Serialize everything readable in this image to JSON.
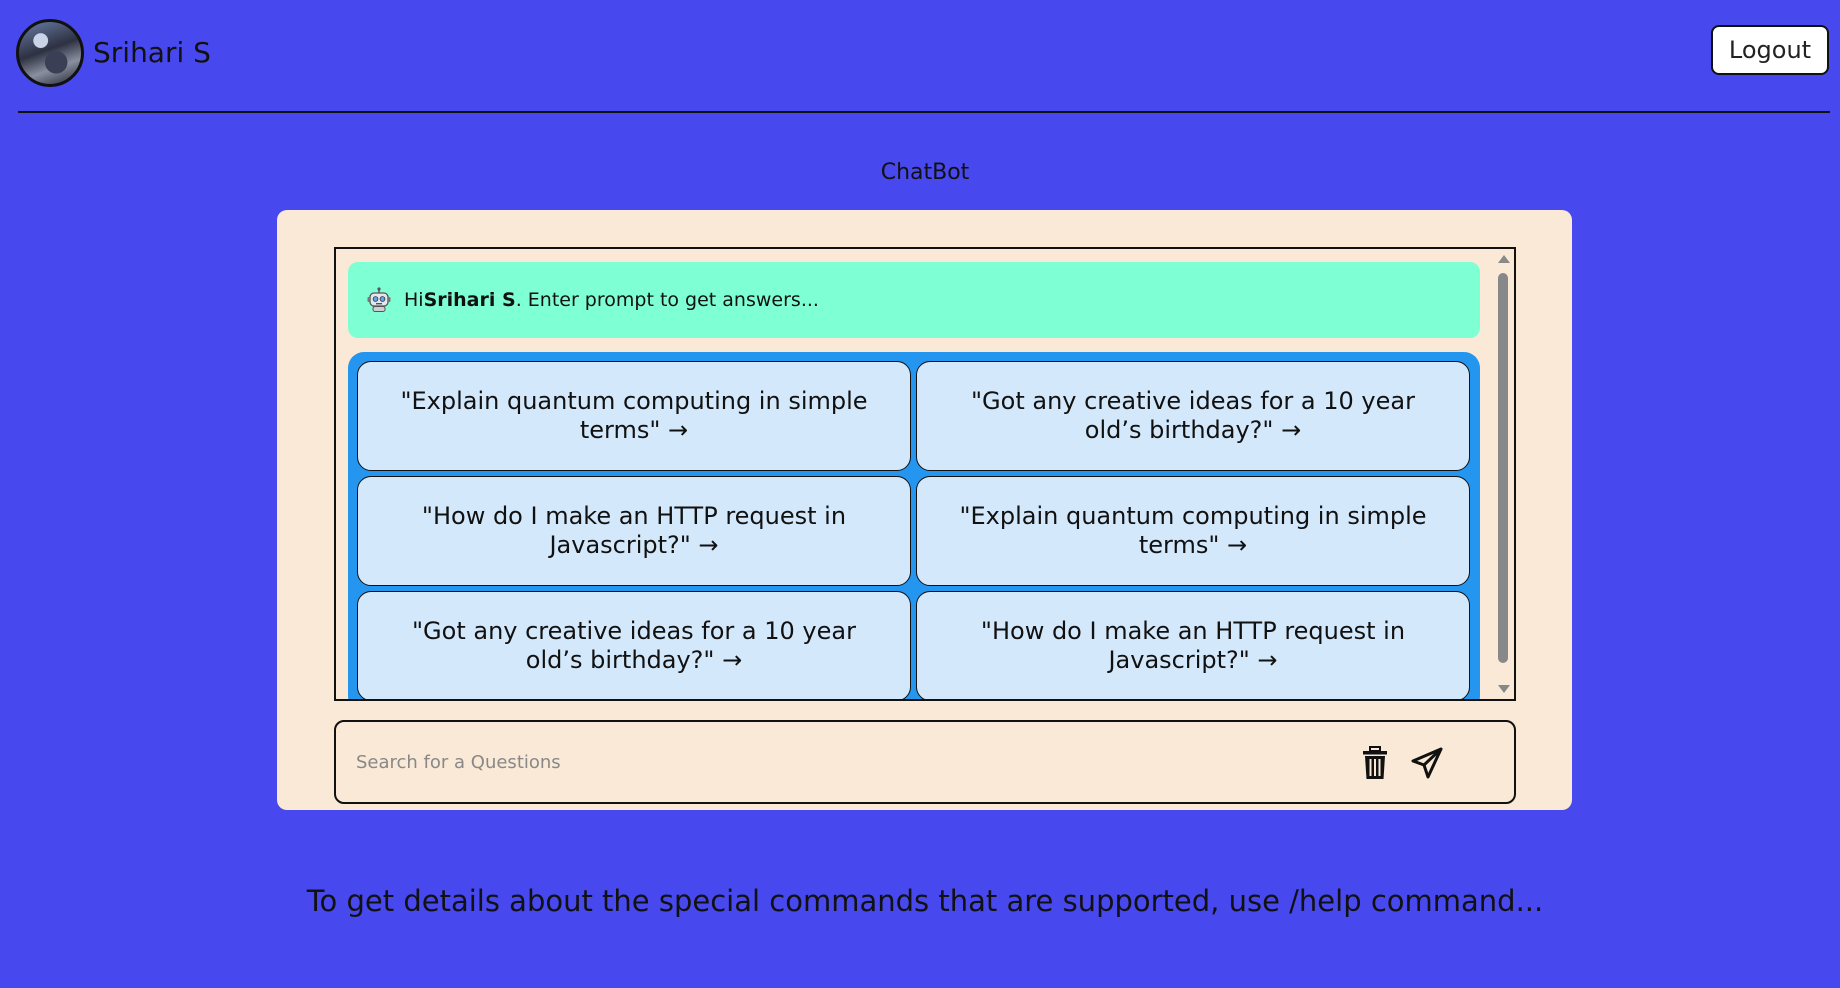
{
  "header": {
    "user_name": "Srihari S",
    "logout_label": "Logout"
  },
  "page_title": "ChatBot",
  "greeting": {
    "prefix": "Hi ",
    "name": "Srihari S",
    "suffix": ". Enter prompt to get answers..."
  },
  "suggestions": [
    "\"Explain quantum computing in simple terms\" →",
    "\"Got any creative ideas for a 10 year old’s birthday?\" →",
    "\"How do I make an HTTP request in Javascript?\" →",
    "\"Explain quantum computing in simple terms\" →",
    "\"Got any creative ideas for a 10 year old’s birthday?\" →",
    "\"How do I make an HTTP request in Javascript?\" →"
  ],
  "search": {
    "placeholder": "Search for a Questions",
    "value": ""
  },
  "icons": {
    "avatar": "user-avatar",
    "bot": "robot-icon",
    "delete": "trash-icon",
    "send": "send-icon"
  },
  "colors": {
    "background": "#4848ef",
    "card": "#f9e9d6",
    "greeting_bg": "#7fffd4",
    "suggest_panel": "#2596f0",
    "suggest_button": "#d4e8fb"
  },
  "help_text": "To get details about the special commands that are supported, use /help command..."
}
